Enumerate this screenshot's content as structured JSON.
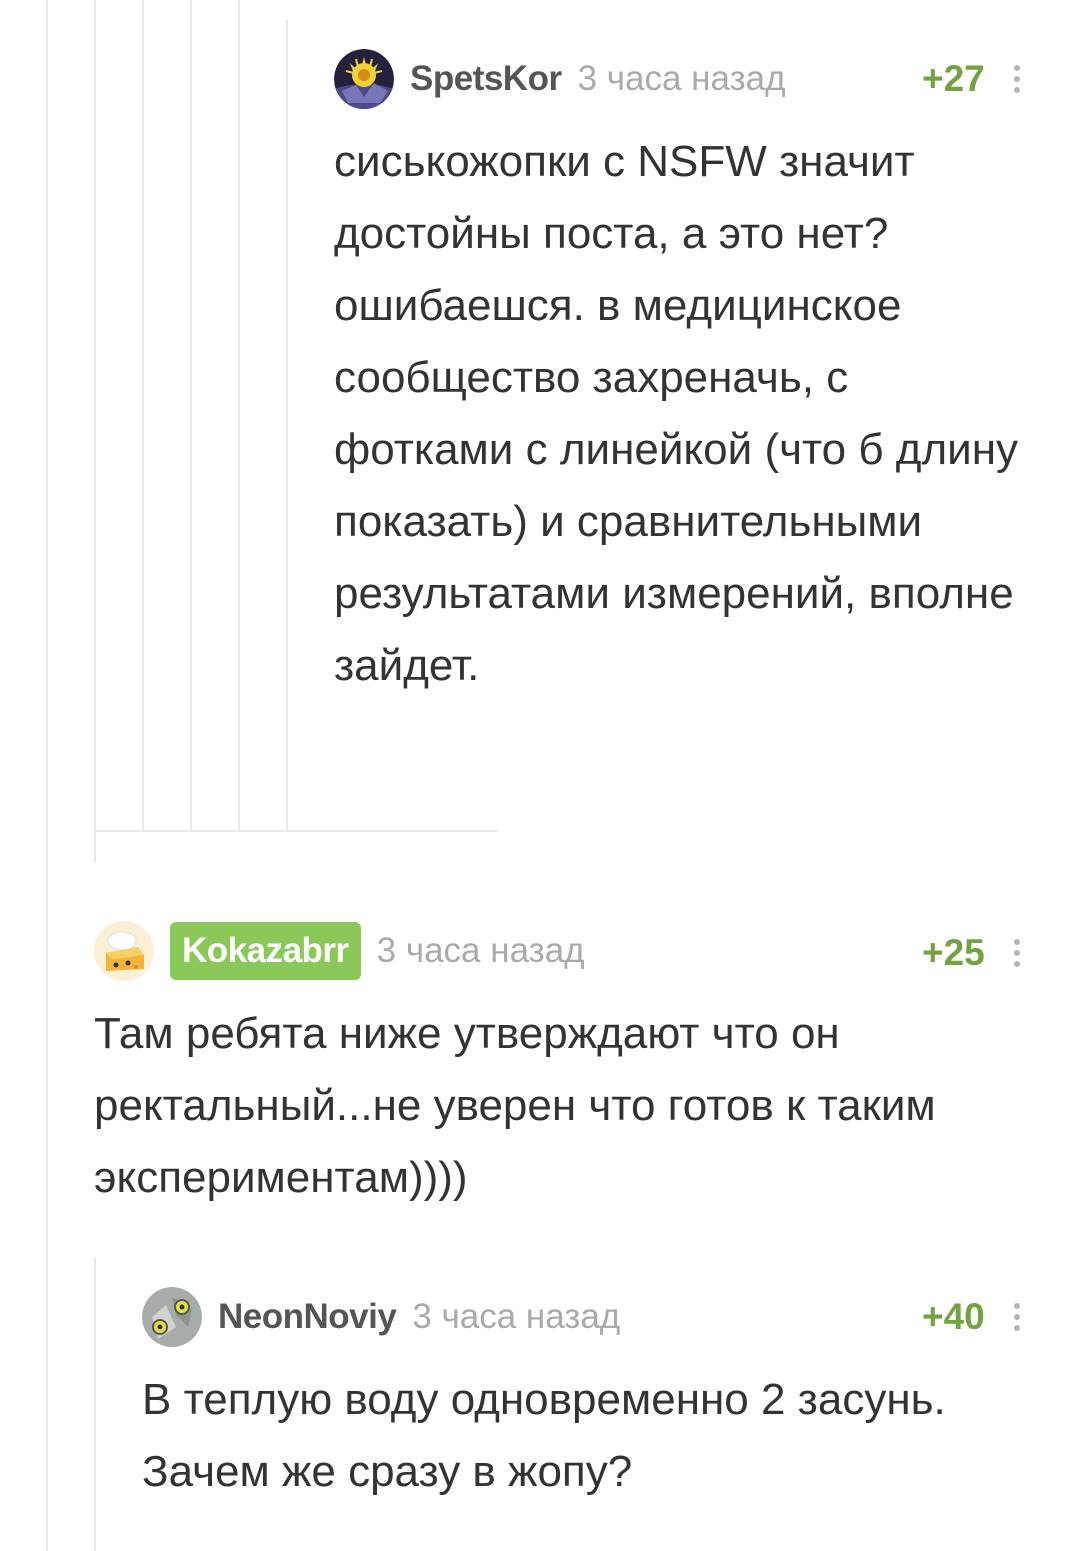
{
  "comments": [
    {
      "username": "SpetsKor",
      "time": "3 часа назад",
      "rating": "+27",
      "avatar_icon": "flower-burst-avatar",
      "text": "сиськожопки с NSFW значит достойны поста, а это нет? ошибаешся. в медицинское сообщество захреначь, с фотками с линейкой (что б длину показать) и сравнительными результатами измерений, вполне зайдет."
    },
    {
      "username": "Kokazabrr",
      "username_is_badge": true,
      "time": "3 часа назад",
      "rating": "+25",
      "avatar_icon": "cheese-chef-avatar",
      "text": "Там ребята ниже утверждают что он ректальный...не уверен что готов к таким экспериментам))))"
    },
    {
      "username": "NeonNoviy",
      "time": "3 часа назад",
      "rating": "+40",
      "avatar_icon": "robot-face-avatar",
      "text": "В теплую воду одновременно 2 засунь. Зачем же сразу в жопу?"
    }
  ],
  "colors": {
    "rating": "#72a340",
    "badge": "#8ac858",
    "thread_line": "#e8e8e8",
    "meta_text": "#aaaaaa",
    "body_text": "#333333"
  },
  "icons": {
    "more": "vertical-dots-icon"
  }
}
